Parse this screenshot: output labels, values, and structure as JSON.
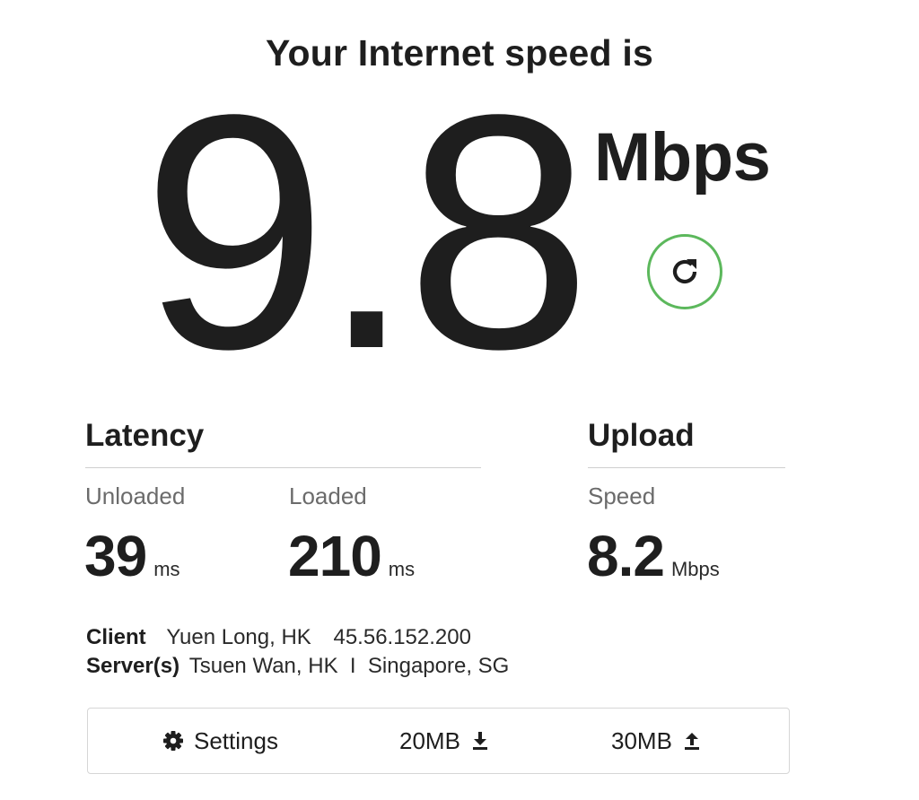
{
  "headline": "Your Internet speed is",
  "download": {
    "value": "9.8",
    "unit": "Mbps"
  },
  "refresh": {
    "icon": "refresh-icon",
    "ring_color": "#5cb85c"
  },
  "latency": {
    "title": "Latency",
    "unloaded": {
      "label": "Unloaded",
      "value": "39",
      "unit": "ms"
    },
    "loaded": {
      "label": "Loaded",
      "value": "210",
      "unit": "ms"
    }
  },
  "upload": {
    "title": "Upload",
    "speed": {
      "label": "Speed",
      "value": "8.2",
      "unit": "Mbps"
    }
  },
  "info": {
    "client_label": "Client",
    "client_location": "Yuen Long, HK",
    "client_ip": "45.56.152.200",
    "servers_label": "Server(s)",
    "servers_value": "Tsuen Wan, HK  I  Singapore, SG"
  },
  "options": {
    "settings_label": "Settings",
    "settings_icon": "gear-icon",
    "download_size": "20MB",
    "download_icon": "download-icon",
    "upload_size": "30MB",
    "upload_icon": "upload-icon"
  }
}
